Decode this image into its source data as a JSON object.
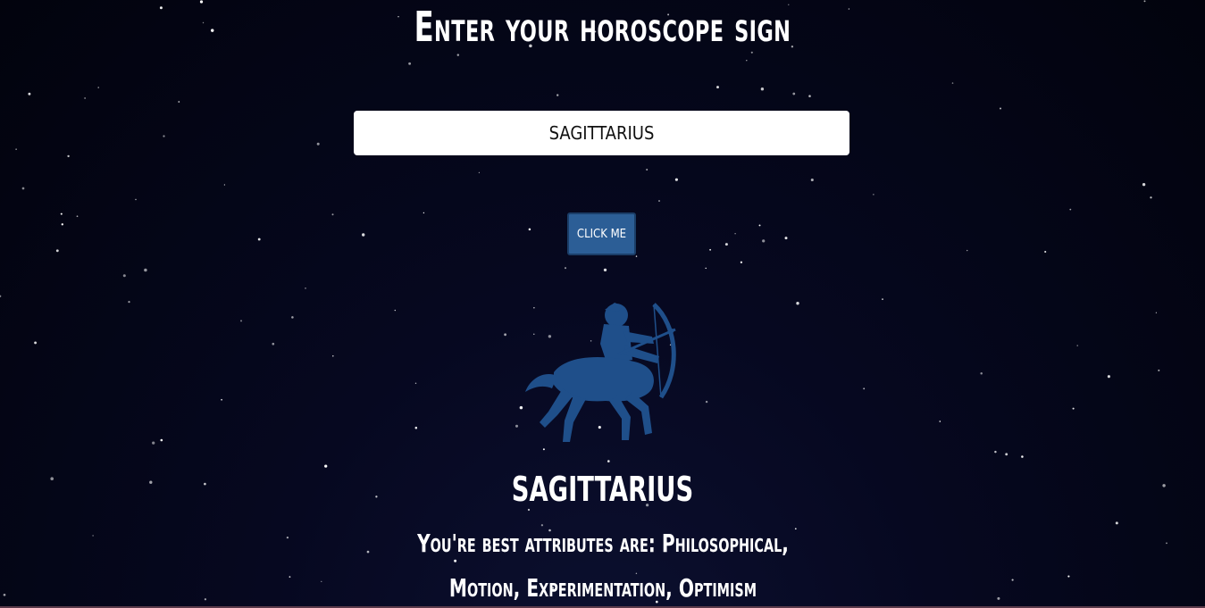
{
  "header": {
    "title": "Enter your horoscope sign"
  },
  "form": {
    "sign_input_value": "SAGITTARIUS",
    "button_label": "CLICK ME"
  },
  "result": {
    "image_icon": "sagittarius-archer-icon",
    "sign_name": "SAGITTARIUS",
    "attributes_text": "You're best attributes are: Philosophical, Motion, Experimentation, Optimism"
  },
  "colors": {
    "background": "#02030d",
    "button": "#2c5e96",
    "sign_image": "#1f4f8a",
    "text": "#ffffff"
  }
}
